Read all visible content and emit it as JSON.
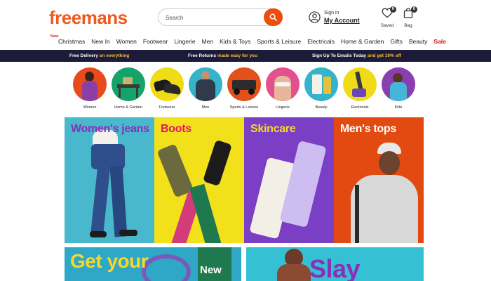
{
  "header": {
    "logo": "freemans",
    "search_placeholder": "Search",
    "signin_label": "Sign in",
    "account_label": "My Account",
    "saved_label": "Saved",
    "saved_count": "0",
    "bag_label": "Bag",
    "bag_count": "0"
  },
  "nav": {
    "new_tag": "New",
    "items": [
      "Christmas",
      "New In",
      "Women",
      "Footwear",
      "Lingerie",
      "Men",
      "Kids & Toys",
      "Sports & Leisure",
      "Electricals",
      "Home & Garden",
      "Gifts",
      "Beauty",
      "Sale"
    ]
  },
  "promo": {
    "delivery_a": "Free Delivery",
    "delivery_b": "on everything",
    "returns_a": "Free Returns",
    "returns_b": "made easy for you",
    "signup_a": "Sign Up To Emails Today",
    "signup_b": "and get 10% off"
  },
  "categories": [
    "Women",
    "Home & Garden",
    "Footwear",
    "Men",
    "Sports & Leisure",
    "Lingerie",
    "Beauty",
    "Electricals",
    "Kids"
  ],
  "tiles": [
    "Women's jeans",
    "Boots",
    "Skincare",
    "Men's tops"
  ],
  "banners": {
    "left": "Get your",
    "left_badge": "New",
    "right": "Slay"
  },
  "colors": {
    "brand": "#ee5a1f",
    "promo_bg": "#1c1b3a",
    "promo_highlight": "#f5c038",
    "sale": "#d0150f",
    "tile_jeans": "#49b7cc",
    "tile_boots": "#f2e01a",
    "tile_skincare": "#7b3fc6",
    "tile_mens": "#e24a12"
  },
  "icons": {
    "search": "search-icon",
    "account": "user-icon",
    "saved": "heart-icon",
    "bag": "bag-icon"
  }
}
